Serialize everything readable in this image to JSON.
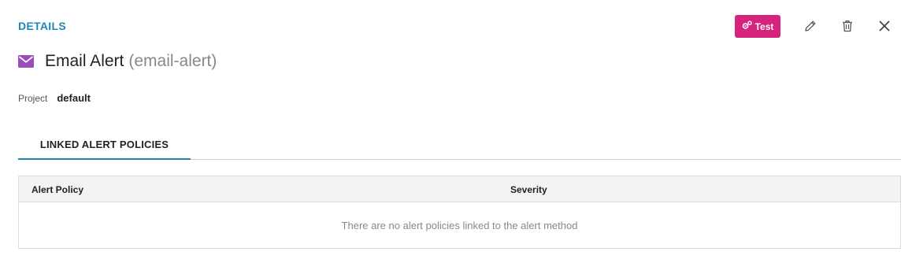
{
  "header": {
    "title": "DETAILS"
  },
  "toolbar": {
    "test_label": "Test",
    "test_color": "#d6237e"
  },
  "alert": {
    "name": "Email Alert",
    "slug": "(email-alert)",
    "icon": "envelope-icon",
    "icon_color": "#9b4dba"
  },
  "meta": {
    "project_label": "Project",
    "project_value": "default"
  },
  "tabs": [
    {
      "label": "LINKED ALERT POLICIES",
      "active": true
    }
  ],
  "table": {
    "columns": [
      "Alert Policy",
      "Severity"
    ],
    "rows": [],
    "empty_message": "There are no alert policies linked to the alert method"
  },
  "colors": {
    "accent": "#1f86b8",
    "brand": "#d6237e"
  }
}
